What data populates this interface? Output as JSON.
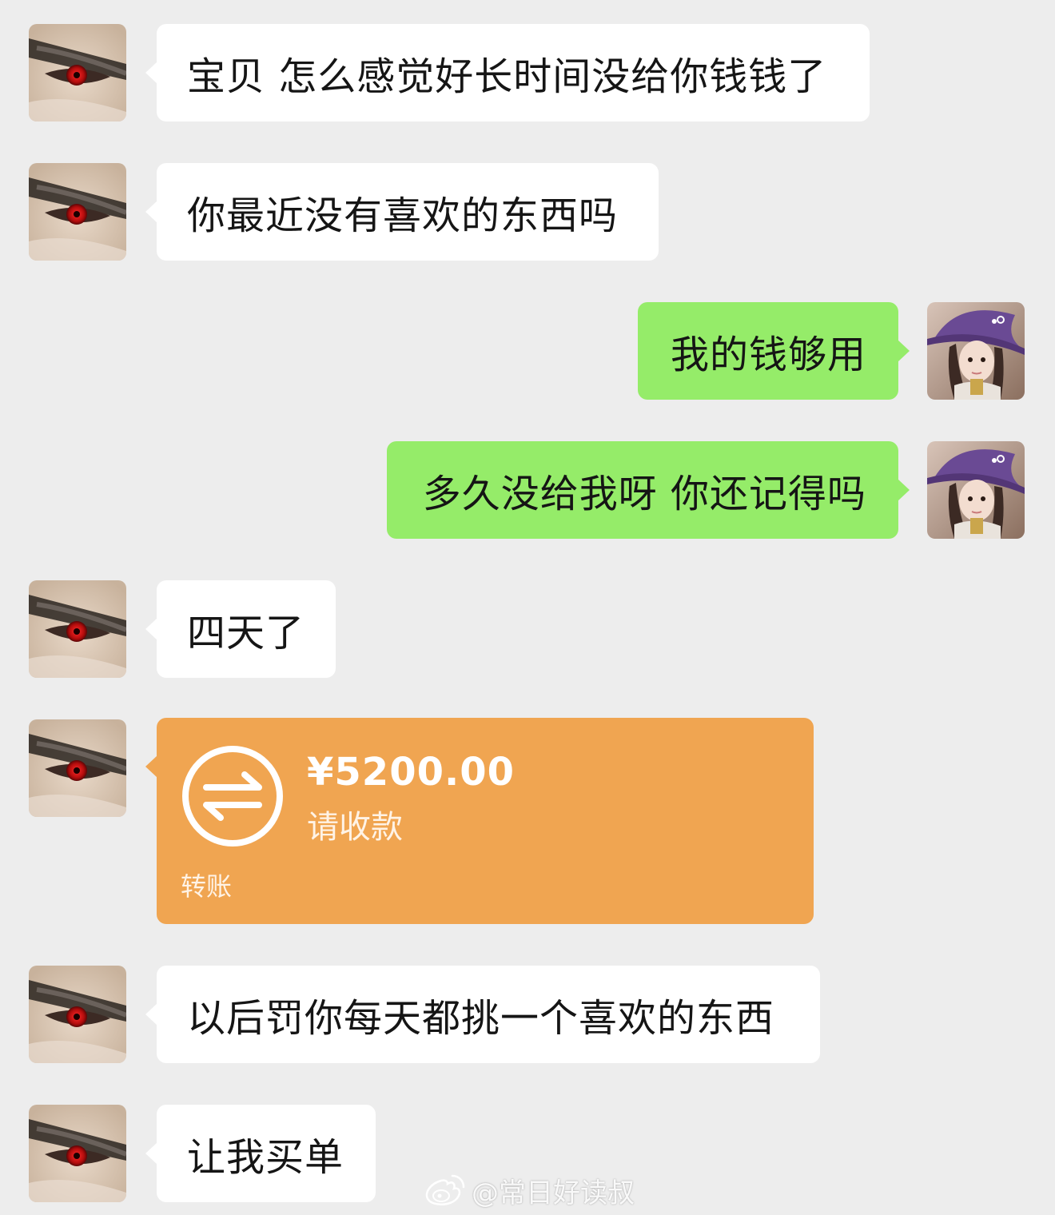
{
  "messages": [
    {
      "sender": "other",
      "text": "宝贝 怎么感觉好长时间没给你钱钱了"
    },
    {
      "sender": "other",
      "text": "你最近没有喜欢的东西吗"
    },
    {
      "sender": "self",
      "text": "我的钱够用"
    },
    {
      "sender": "self",
      "text": "多久没给我呀 你还记得吗"
    },
    {
      "sender": "other",
      "text": "四天了"
    },
    {
      "sender": "other",
      "type": "transfer",
      "amount": "¥5200.00",
      "status": "请收款",
      "label": "转账"
    },
    {
      "sender": "other",
      "text": "以后罚你每天都挑一个喜欢的东西"
    },
    {
      "sender": "other",
      "text": "让我买单"
    }
  ],
  "watermark": {
    "text": "@常日好读叔",
    "icon": "weibo-icon"
  },
  "colors": {
    "background": "#ededed",
    "incoming_bubble": "#ffffff",
    "outgoing_bubble": "#95ec69",
    "transfer_card": "#f0a551"
  },
  "icons": {
    "other_avatar": "red-eye-avatar-icon",
    "self_avatar": "witch-hat-girl-avatar-icon",
    "transfer": "exchange-arrows-icon"
  }
}
